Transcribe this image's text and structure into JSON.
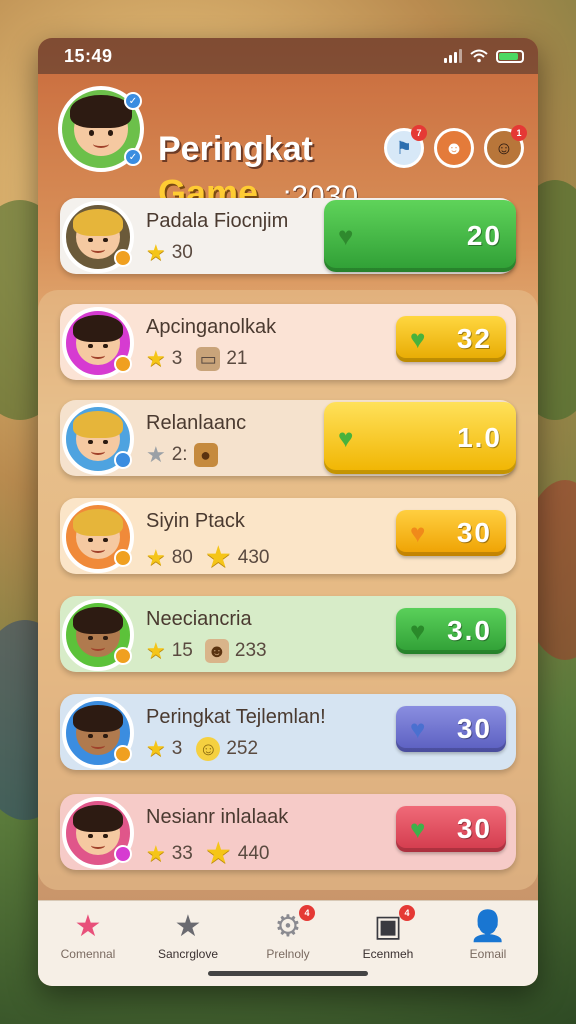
{
  "status": {
    "time": "15:49"
  },
  "header": {
    "title_line1": "Peringkat",
    "title_line2": "Game",
    "title_suffix": ":2030",
    "icons": [
      {
        "name": "badge-icon",
        "notif": "7"
      },
      {
        "name": "owl-icon",
        "notif": ""
      },
      {
        "name": "friend-avatar-icon",
        "notif": "1"
      }
    ]
  },
  "players": [
    {
      "name": "Padala Fiocnjim",
      "stars": "30",
      "extra": "",
      "score": "20",
      "color": "#4caf50"
    },
    {
      "name": "Apcinganolkak",
      "stars": "3",
      "extra": "21",
      "score": "32",
      "color": "#f2c21b"
    },
    {
      "name": "Relanlaanc",
      "stars": "2:",
      "extra": "",
      "score": "1.0",
      "color": "#f5c11a"
    },
    {
      "name": "Siyin Ptack",
      "stars": "80",
      "extra": "430",
      "score": "30",
      "color": "#f3b21c"
    },
    {
      "name": "Neeciancria",
      "stars": "15",
      "extra": "233",
      "score": "3.0",
      "color": "#3fb04a"
    },
    {
      "name": "Peringkat Tejlemlan!",
      "stars": "3",
      "extra": "252",
      "score": "30",
      "color": "#6a6ecf"
    },
    {
      "name": "Nesianr inlalaak",
      "stars": "33",
      "extra": "440",
      "score": "30",
      "color": "#e05362"
    }
  ],
  "tabs": [
    {
      "label": "Comennal",
      "icon": "star-icon",
      "notif": ""
    },
    {
      "label": "Sancrglove",
      "icon": "star-outline-icon",
      "notif": ""
    },
    {
      "label": "Prelnoly",
      "icon": "gear-icon",
      "notif": "4"
    },
    {
      "label": "Ecenmeh",
      "icon": "image-icon",
      "notif": "4"
    },
    {
      "label": "Eomail",
      "icon": "user-icon",
      "notif": ""
    }
  ]
}
